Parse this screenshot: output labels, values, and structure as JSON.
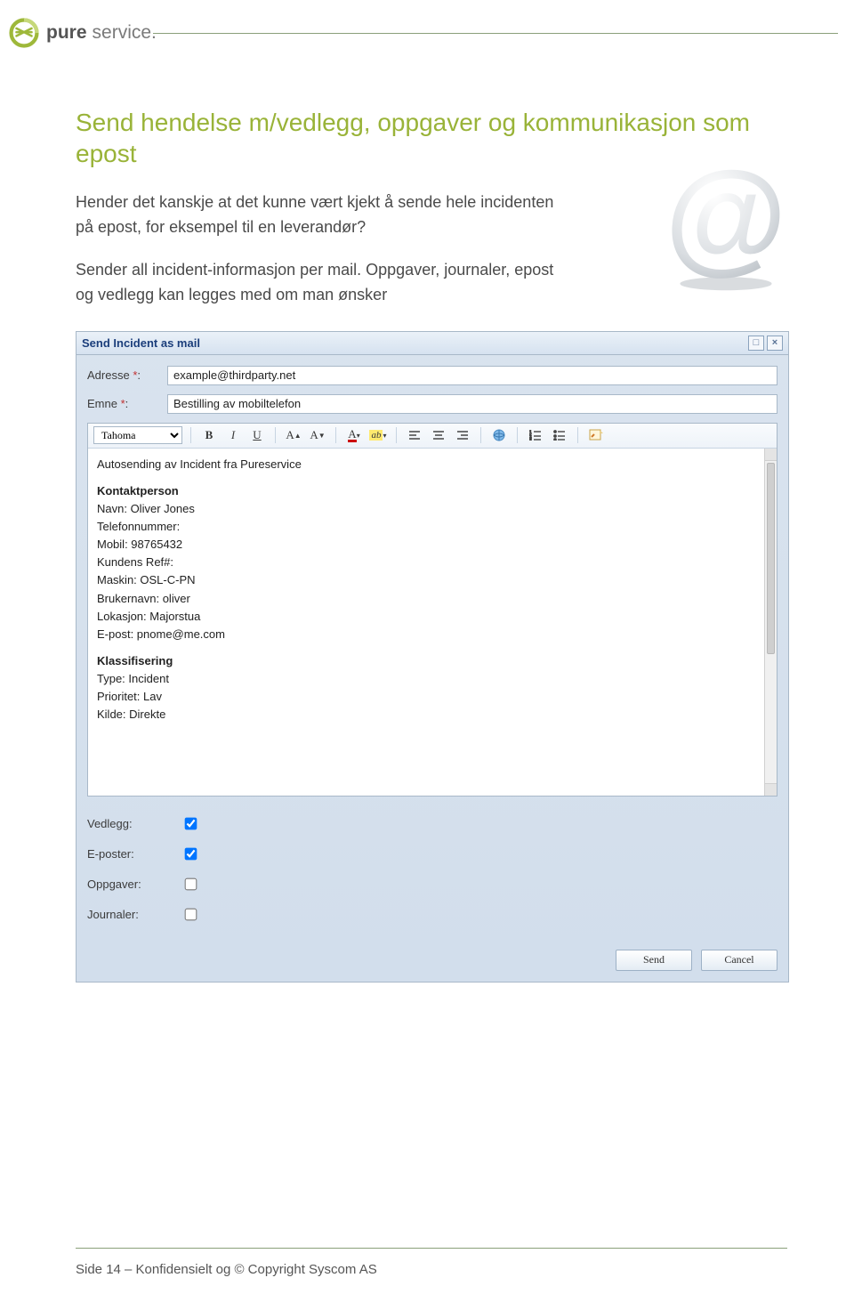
{
  "brand": {
    "part1": "pure",
    "part2": "service."
  },
  "section": {
    "title": "Send hendelse m/vedlegg, oppgaver og kommunikasjon som epost",
    "para1": "Hender det kanskje at det kunne vært kjekt å sende hele incidenten på epost, for eksempel til en leverandør?",
    "para2": "Sender all incident-informasjon per mail. Oppgaver, journaler, epost og vedlegg kan legges med om man ønsker"
  },
  "widget": {
    "title": "Send Incident as mail",
    "fields": {
      "address_label": "Adresse",
      "address_value": "example@thirdparty.net",
      "subject_label": "Emne",
      "subject_value": "Bestilling av mobiltelefon",
      "required_mark": "*",
      "colon": ":"
    },
    "toolbar": {
      "font": "Tahoma"
    },
    "body": {
      "intro": "Autosending av Incident fra Pureservice",
      "h1": "Kontaktperson",
      "lines1": [
        "Navn: Oliver Jones",
        "Telefonnummer:",
        "Mobil: 98765432",
        "Kundens Ref#:",
        "Maskin: OSL-C-PN",
        "Brukernavn: oliver",
        "Lokasjon: Majorstua",
        "E-post: pnome@me.com"
      ],
      "h2": "Klassifisering",
      "lines2": [
        "Type: Incident",
        "Prioritet: Lav",
        "Kilde: Direkte"
      ]
    },
    "checks": {
      "attachments": {
        "label": "Vedlegg:",
        "checked": true
      },
      "emails": {
        "label": "E-poster:",
        "checked": true
      },
      "tasks": {
        "label": "Oppgaver:",
        "checked": false
      },
      "journals": {
        "label": "Journaler:",
        "checked": false
      }
    },
    "buttons": {
      "send": "Send",
      "cancel": "Cancel"
    }
  },
  "footer": "Side 14 – Konfidensielt og © Copyright Syscom AS"
}
